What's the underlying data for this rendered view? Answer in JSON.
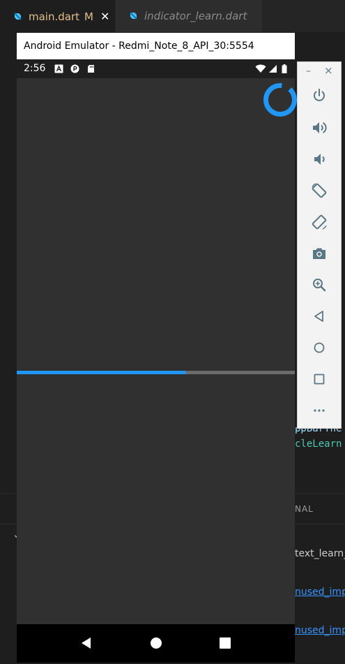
{
  "editor": {
    "tabs": [
      {
        "label": "main.dart",
        "modified": "M",
        "close": "✕"
      },
      {
        "label": "indicator_learn.dart"
      }
    ],
    "peek_lines": {
      "appbar": "ppBarThe",
      "class": "cleLearn"
    },
    "panel": {
      "label": "NAL",
      "file": "text_learn_",
      "link1": "nused_imp",
      "link2": "nused_imp"
    }
  },
  "emulator": {
    "title": "Android Emulator - Redmi_Note_8_API_30:5554",
    "status_bar": {
      "time": "2:56"
    },
    "linear_progress": {
      "value": 0.61
    },
    "circular_progress": {
      "value": 0.9
    },
    "colors": {
      "accent": "#2196f3",
      "track": "#6b6b6b",
      "background": "#303030"
    },
    "toolbar": {
      "minimize": "–",
      "close": "×",
      "buttons": [
        "power-icon",
        "volume-up-icon",
        "volume-down-icon",
        "rotate-left-icon",
        "rotate-right-icon",
        "camera-icon",
        "zoom-icon",
        "back-icon",
        "home-icon",
        "overview-icon",
        "more-icon"
      ]
    }
  }
}
